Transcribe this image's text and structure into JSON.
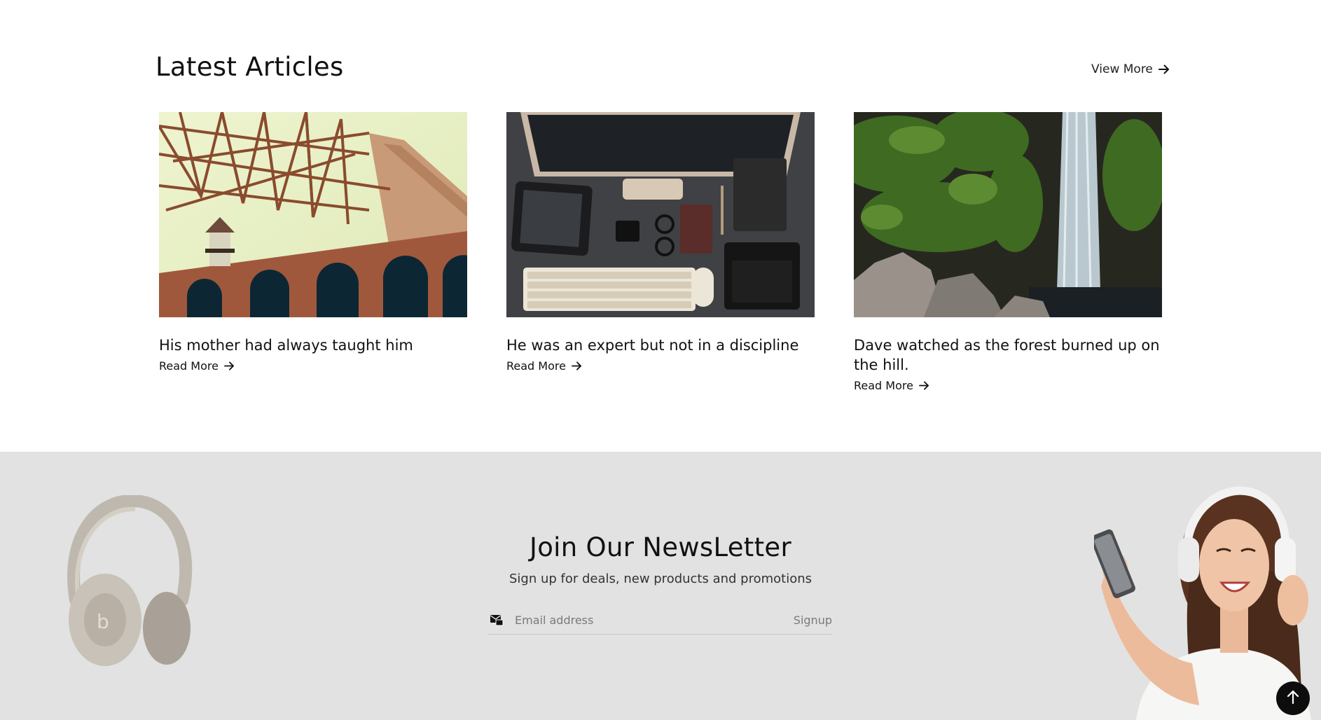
{
  "articles": {
    "heading": "Latest Articles",
    "view_more_label": "View More",
    "items": [
      {
        "title": "His mother had always taught him",
        "read_more": "Read More",
        "image": "golden-gate-bridge-photo"
      },
      {
        "title": "He was an expert but not in a discipline",
        "read_more": "Read More",
        "image": "desk-workspace-photo"
      },
      {
        "title": "Dave watched as the forest burned up on the hill.",
        "read_more": "Read More",
        "image": "waterfall-photo"
      }
    ]
  },
  "newsletter": {
    "heading": "Join Our NewsLetter",
    "subheading": "Sign up for deals, new products and promotions",
    "email_placeholder": "Email address",
    "email_value": "",
    "signup_label": "Signup",
    "left_image": "headphones-product-image",
    "right_image": "woman-with-headphones-image"
  },
  "icons": {
    "arrow": "arrow-right-icon",
    "mail": "mail-icon",
    "scroll_top": "arrow-up-icon"
  },
  "colors": {
    "newsletter_bg": "#e1e2e1",
    "text": "#111111",
    "scroll_top_bg": "#0d0d0d"
  }
}
